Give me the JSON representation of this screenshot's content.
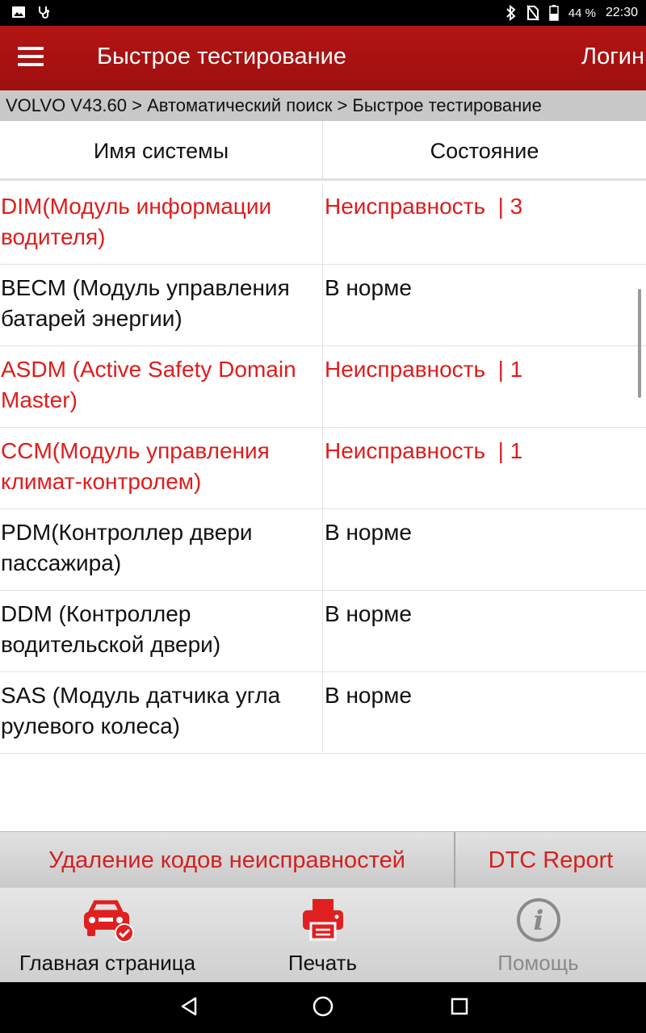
{
  "status_bar": {
    "battery": "44 %",
    "time": "22:30",
    "icons": [
      "image-icon",
      "stethoscope-icon",
      "bluetooth-icon",
      "no-sim-icon",
      "battery-icon"
    ]
  },
  "app_bar": {
    "title": "Быстрое тестирование",
    "login": "Логин",
    "menu_icon": "hamburger-menu-icon"
  },
  "breadcrumb": "VOLVO V43.60 > Автоматический поиск > Быстрое тестирование",
  "table": {
    "headers": [
      "Имя системы",
      "Состояние"
    ],
    "rows": [
      {
        "name": "DIM(Модуль информации водителя)",
        "state": "Неисправность  | 3",
        "fault": true
      },
      {
        "name": "BECM (Модуль управления батарей энергии)",
        "state": "В норме",
        "fault": false
      },
      {
        "name": "ASDM (Active Safety Domain Master)",
        "state": "Неисправность  | 1",
        "fault": true
      },
      {
        "name": "CCM(Модуль управления климат-контролем)",
        "state": "Неисправность  | 1",
        "fault": true
      },
      {
        "name": "PDM(Контроллер двери пассажира)",
        "state": "В норме",
        "fault": false
      },
      {
        "name": "DDM (Контроллер водительской двери)",
        "state": "В норме",
        "fault": false
      },
      {
        "name": "SAS (Модуль датчика угла рулевого колеса)",
        "state": "В норме",
        "fault": false
      }
    ]
  },
  "actions": {
    "clear_codes": "Удаление кодов неисправностей",
    "dtc_report": "DTC Report"
  },
  "bottom_nav": {
    "home": {
      "label": "Главная страница",
      "icon": "car-check-icon"
    },
    "print": {
      "label": "Печать",
      "icon": "printer-icon"
    },
    "help": {
      "label": "Помощь",
      "icon": "info-icon"
    }
  },
  "colors": {
    "app_bar": "#b31514",
    "fault_text": "#e01c1c",
    "accent_red": "#d42020"
  }
}
